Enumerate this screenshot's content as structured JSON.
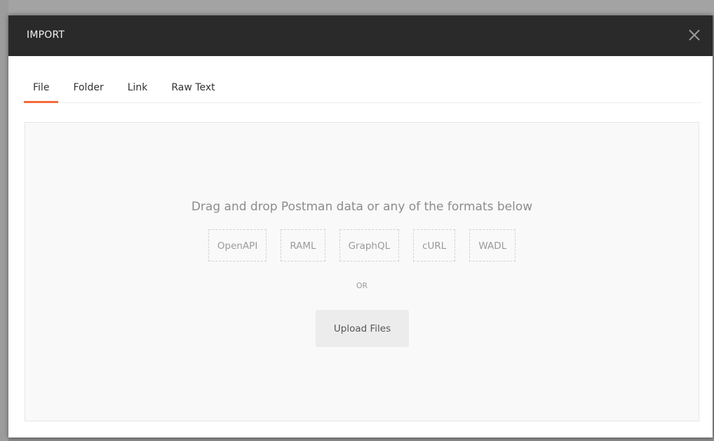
{
  "modal": {
    "title": "IMPORT",
    "close_icon": "close-icon"
  },
  "tabs": [
    {
      "label": "File",
      "active": true
    },
    {
      "label": "Folder",
      "active": false
    },
    {
      "label": "Link",
      "active": false
    },
    {
      "label": "Raw Text",
      "active": false
    }
  ],
  "dropzone": {
    "instruction": "Drag and drop Postman data or any of the formats below",
    "formats": [
      "OpenAPI",
      "RAML",
      "GraphQL",
      "cURL",
      "WADL"
    ],
    "or_label": "OR",
    "upload_label": "Upload Files"
  },
  "colors": {
    "header_bg": "#2a2a2a",
    "accent": "#f26b3a"
  }
}
